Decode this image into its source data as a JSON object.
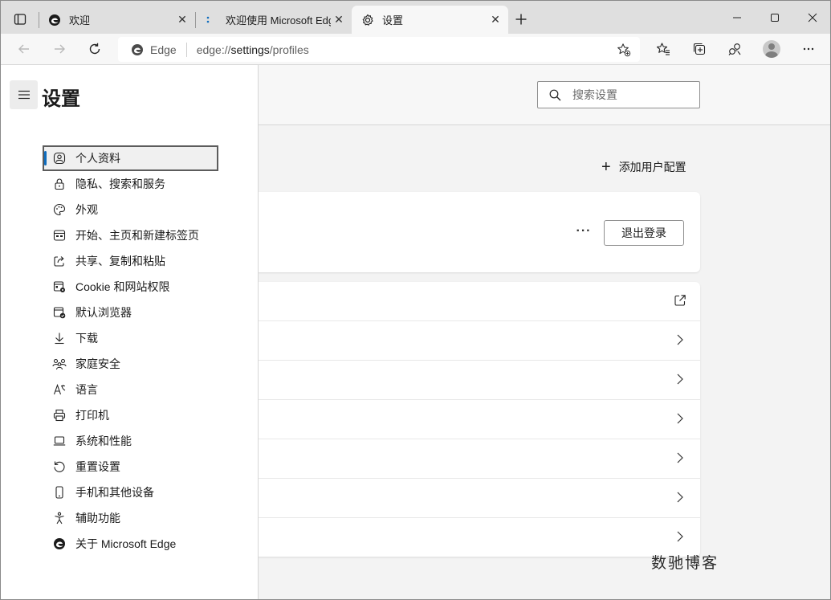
{
  "tabs": [
    {
      "label": "欢迎",
      "icon": "edge-icon",
      "active": false
    },
    {
      "label": "欢迎使用 Microsoft Edge",
      "icon": "loading-dots-icon",
      "active": false
    },
    {
      "label": "设置",
      "icon": "gear-icon",
      "active": true
    }
  ],
  "address_bar": {
    "site_name": "Edge",
    "url_prefix": "edge://",
    "url_host": "settings",
    "url_path": "/profiles"
  },
  "header": {
    "search_placeholder": "搜索设置"
  },
  "sidebar": {
    "title": "设置",
    "items": [
      {
        "label": "个人资料",
        "icon": "profile-icon",
        "active": true
      },
      {
        "label": "隐私、搜索和服务",
        "icon": "lock-icon",
        "active": false
      },
      {
        "label": "外观",
        "icon": "palette-icon",
        "active": false
      },
      {
        "label": "开始、主页和新建标签页",
        "icon": "home-tab-icon",
        "active": false
      },
      {
        "label": "共享、复制和粘贴",
        "icon": "share-icon",
        "active": false
      },
      {
        "label": "Cookie 和网站权限",
        "icon": "cookie-permissions-icon",
        "active": false
      },
      {
        "label": "默认浏览器",
        "icon": "default-browser-icon",
        "active": false
      },
      {
        "label": "下载",
        "icon": "download-icon",
        "active": false
      },
      {
        "label": "家庭安全",
        "icon": "family-icon",
        "active": false
      },
      {
        "label": "语言",
        "icon": "language-icon",
        "active": false
      },
      {
        "label": "打印机",
        "icon": "printer-icon",
        "active": false
      },
      {
        "label": "系统和性能",
        "icon": "laptop-icon",
        "active": false
      },
      {
        "label": "重置设置",
        "icon": "reset-icon",
        "active": false
      },
      {
        "label": "手机和其他设备",
        "icon": "phone-icon",
        "active": false
      },
      {
        "label": "辅助功能",
        "icon": "accessibility-icon",
        "active": false
      },
      {
        "label": "关于 Microsoft Edge",
        "icon": "edge-icon",
        "active": false
      }
    ]
  },
  "main": {
    "add_profile_label": "添加用户配置",
    "more_label": "···",
    "signout_label": "退出登录",
    "rows": [
      {
        "icon": "external-link-icon"
      },
      {
        "icon": "chevron-right-icon"
      },
      {
        "icon": "chevron-right-icon"
      },
      {
        "icon": "chevron-right-icon"
      },
      {
        "icon": "chevron-right-icon"
      },
      {
        "icon": "chevron-right-icon"
      },
      {
        "icon": "chevron-right-icon"
      }
    ]
  },
  "watermark": "数驰博客",
  "colors": {
    "accent": "#0f6cbd",
    "titlebar": "#dfdfdf",
    "page_bg": "#f3f3f3"
  }
}
